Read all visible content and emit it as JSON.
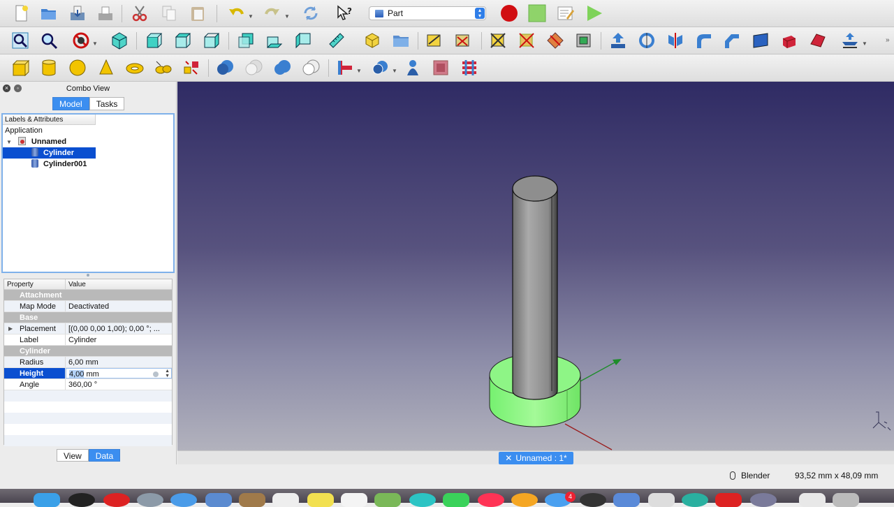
{
  "window": {
    "title": "Combo View"
  },
  "toolbar": {
    "workbench": "Part",
    "row1": [
      "new-icon",
      "open-icon",
      "save-icon",
      "save-as-icon",
      "cut-icon",
      "copy-icon",
      "paste-icon",
      "undo-icon",
      "redo-icon",
      "refresh-icon",
      "whats-this-icon",
      "macro-record-icon",
      "macro-stop-icon",
      "macro-edit-icon",
      "macro-run-icon"
    ],
    "row2": [
      "fit-all-icon",
      "fit-selection-icon",
      "draw-style-icon",
      "isometric-view-icon",
      "front-view-icon",
      "top-view-icon",
      "right-view-icon",
      "rear-view-icon",
      "bottom-view-icon",
      "left-view-icon",
      "measure-distance-icon",
      "make-part-icon",
      "create-group-icon",
      "measure-linear-icon",
      "measure-angular-icon",
      "measure-refresh-icon",
      "measure-clear-icon",
      "measure-toggle-all-icon",
      "measure-toggle-3d-icon",
      "extrude-icon",
      "revolve-icon",
      "mirror-icon",
      "fillet-icon",
      "chamfer-icon",
      "make-face-icon",
      "ruled-surface-icon",
      "loft-icon",
      "section-icon"
    ],
    "row3": [
      "box-icon",
      "cylinder-icon",
      "sphere-icon",
      "cone-icon",
      "torus-icon",
      "tube-icon",
      "primitives-icon",
      "shape-builder-icon",
      "boolean-icon",
      "cut-boolean-icon",
      "fuse-icon",
      "common-icon",
      "join-features-icon",
      "split-features-icon",
      "check-geometry-icon",
      "defeaturing-icon",
      "cross-sections-icon"
    ]
  },
  "combo": {
    "title": "Combo View",
    "tabs": [
      {
        "label": "Model",
        "selected": true
      },
      {
        "label": "Tasks",
        "selected": false
      }
    ],
    "tree": {
      "header": "Labels & Attributes",
      "root": "Application",
      "document": "Unnamed",
      "items": [
        {
          "label": "Cylinder",
          "selected": true
        },
        {
          "label": "Cylinder001",
          "selected": false
        }
      ]
    },
    "properties": {
      "headers": {
        "property": "Property",
        "value": "Value"
      },
      "groups": [
        {
          "name": "Attachment",
          "rows": [
            {
              "name": "Map Mode",
              "value": "Deactivated"
            }
          ]
        },
        {
          "name": "Base",
          "rows": [
            {
              "name": "Placement",
              "value": "[(0,00 0,00 1,00); 0,00 °; ...",
              "expandable": true
            },
            {
              "name": "Label",
              "value": "Cylinder"
            }
          ]
        },
        {
          "name": "Cylinder",
          "rows": [
            {
              "name": "Radius",
              "value": "6,00 mm"
            },
            {
              "name": "Height",
              "value_selected": "4,00",
              "value_rest": " mm",
              "editing": true
            },
            {
              "name": "Angle",
              "value": "360,00 °"
            }
          ]
        }
      ]
    },
    "view_tabs": [
      {
        "label": "View",
        "selected": false
      },
      {
        "label": "Data",
        "selected": true
      }
    ]
  },
  "document_tab": {
    "label": "Unnamed : 1*"
  },
  "status": {
    "navigation_style": "Blender",
    "dimensions": "93,52 mm x 48,09 mm"
  },
  "colors": {
    "accent": "#3b8ef0",
    "selection": "#0a4fd0",
    "selected_shape": "#7ef27a",
    "shape_gray": "#8a8a8a"
  },
  "dock": {
    "badges": [
      "4"
    ]
  }
}
